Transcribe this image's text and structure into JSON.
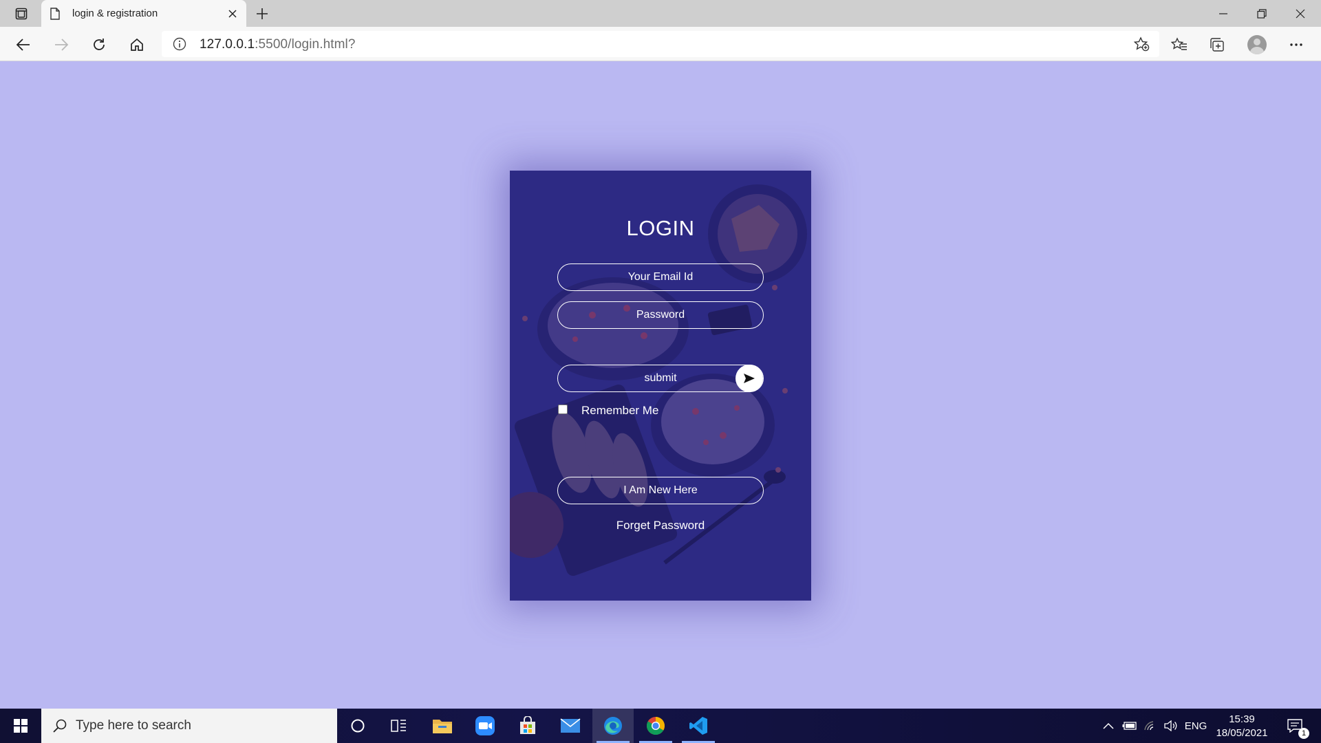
{
  "browser": {
    "tab_title": "login & registration",
    "url_host": "127.0.0.1",
    "url_path": ":5500/login.html?"
  },
  "login": {
    "title": "LOGIN",
    "email_placeholder": "Your Email Id",
    "password_placeholder": "Password",
    "submit_label": "submit",
    "remember_label": "Remember Me",
    "new_here_label": "I Am New Here",
    "forget_label": "Forget Password"
  },
  "taskbar": {
    "search_placeholder": "Type here to search",
    "language": "ENG",
    "time": "15:39",
    "date": "18/05/2021",
    "notification_count": "1"
  },
  "colors": {
    "page_background": "#bab8f2",
    "card_background": "#2f2c86",
    "accent": "#ffffff"
  },
  "icons": [
    "tab-actions-icon",
    "page-icon",
    "close-icon",
    "plus-icon",
    "minimize-icon",
    "restore-icon",
    "back-icon",
    "forward-icon",
    "refresh-icon",
    "home-icon",
    "info-icon",
    "add-favorite-icon",
    "favorites-icon",
    "collections-icon",
    "avatar-icon",
    "more-icon",
    "send-arrow-icon",
    "windows-start-icon",
    "search-icon",
    "cortana-icon",
    "task-view-icon",
    "file-explorer-icon",
    "zoom-icon",
    "store-icon",
    "mail-icon",
    "edge-icon",
    "chrome-icon",
    "vscode-icon",
    "chevron-up-icon",
    "battery-icon",
    "wifi-icon",
    "volume-icon",
    "notification-icon"
  ]
}
